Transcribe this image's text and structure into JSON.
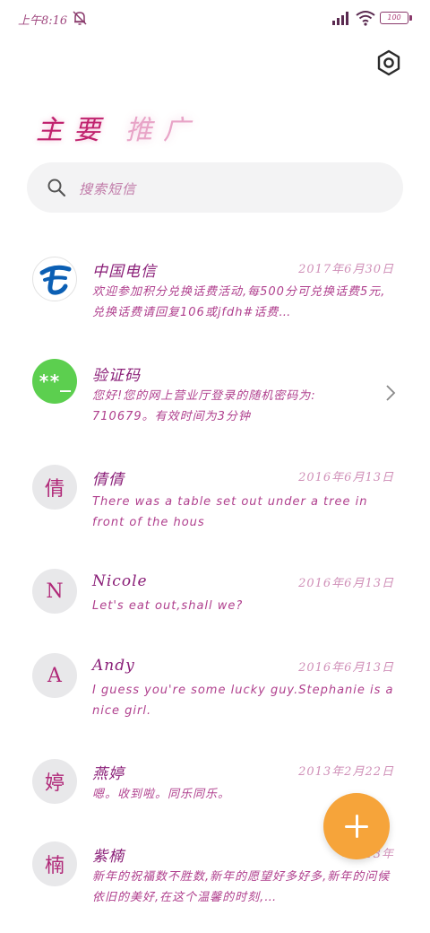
{
  "status_bar": {
    "time": "上午8:16",
    "battery": "100"
  },
  "header": {
    "tab_main": "主要",
    "tab_promo": "推广"
  },
  "search": {
    "placeholder": "搜索短信"
  },
  "messages": [
    {
      "name": "中国电信",
      "date": "2017年6月30日",
      "preview": "欢迎参加积分兑换话费活动,每500分可兑换话费5元,兑换话费请回复106或jfdh#话费…",
      "avatar": "telecom-logo"
    },
    {
      "name": "验证码",
      "date": "",
      "preview": "您好!您的网上营业厅登录的随机密码为: 710679。有效时间为3分钟",
      "avatar_text": "**_"
    },
    {
      "name": "倩倩",
      "date": "2016年6月13日",
      "preview": "There was a table set out under a tree in front of the hous",
      "avatar_text": "倩"
    },
    {
      "name": "Nicole",
      "date": "2016年6月13日",
      "preview": "Let's eat out,shall we?",
      "avatar_text": "N"
    },
    {
      "name": "Andy",
      "date": "2016年6月13日",
      "preview": "I guess you're some lucky guy.Stephanie is a nice girl.",
      "avatar_text": "A"
    },
    {
      "name": "燕婷",
      "date": "2013年2月22日",
      "preview": "嗯。收到啦。同乐同乐。",
      "avatar_text": "婷"
    },
    {
      "name": "紫楠",
      "date": "2013年",
      "preview": "新年的祝福数不胜数,新年的愿望好多好多,新年的问候依旧的美好,在这个温馨的时刻,…",
      "avatar_text": "楠"
    }
  ],
  "colors": {
    "fab": "#f6a43a",
    "green_avatar": "#5ccf4f",
    "telecom_blue": "#0b5fb4"
  }
}
